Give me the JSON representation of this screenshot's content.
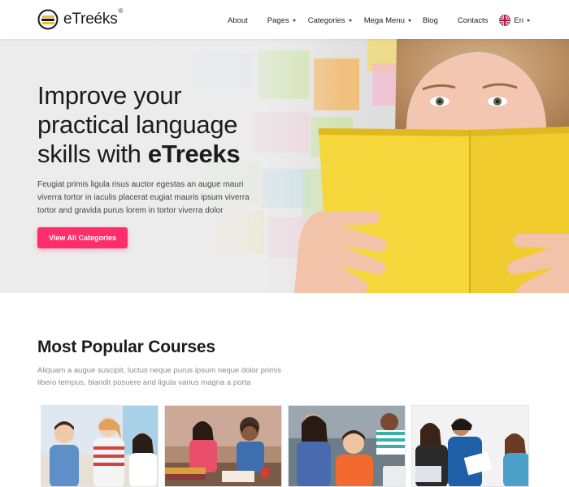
{
  "header": {
    "logo_text": "eTreéks",
    "logo_reg": "®",
    "nav": {
      "about": "About",
      "pages": "Pages",
      "categories": "Categories",
      "mega_menu": "Mega Menu",
      "blog": "Blog",
      "contacts": "Contacts",
      "language": "En"
    }
  },
  "hero": {
    "title_line_1": "Improve your",
    "title_line_2": "practical language",
    "title_line_3_prefix": "skills with ",
    "title_line_3_brand": "eTreeks",
    "description": "Feugiat primis ligula risus auctor egestas an augue mauri viverra tortor in iaculis placerat eugiat mauris ipsum viverra tortor and gravida purus lorem in tortor viverra dolor",
    "button_label": "View All Categories"
  },
  "courses": {
    "title": "Most Popular Courses",
    "description": "Aliquam a augue suscipit, luctus neque purus ipsum neque dolor primis libero tempus, blandit posuere and ligula varius magna a porta"
  },
  "colors": {
    "accent": "#ff2d6b",
    "note_yellow": "#f5d63b",
    "note_orange": "#f6a637",
    "note_green": "#b9e07a",
    "note_blue": "#8fd0ea",
    "note_pink": "#f5a8c4"
  }
}
